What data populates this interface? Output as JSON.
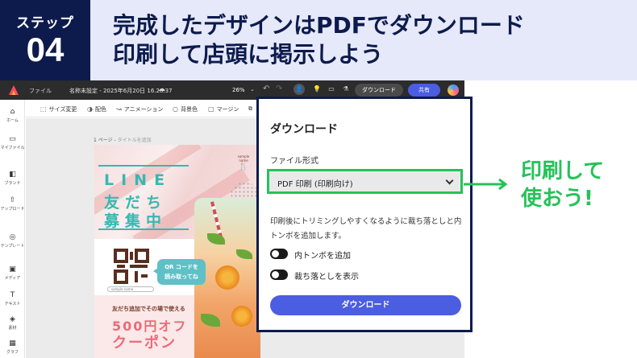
{
  "banner": {
    "step_label": "ステップ",
    "step_number": "04",
    "title_line1": "完成したデザインはPDFでダウンロード",
    "title_line2": "印刷して店頭に掲示しよう"
  },
  "app": {
    "topbar": {
      "menu_file": "ファイル",
      "document_name": "名称未設定 - 2025年6月20日 16.28.37",
      "zoom": "26%",
      "download_label": "ダウンロード",
      "share_label": "共有"
    },
    "sidebar": [
      {
        "icon": "home-icon",
        "label": "ホーム"
      },
      {
        "icon": "folder-icon",
        "label": "マイファイル"
      },
      {
        "icon": "brand-icon",
        "label": "ブランド"
      },
      {
        "icon": "upload-icon",
        "label": "アップロード"
      },
      {
        "icon": "template-icon",
        "label": "テンプレート"
      },
      {
        "icon": "media-icon",
        "label": "メディア"
      },
      {
        "icon": "text-icon",
        "label": "テキスト"
      },
      {
        "icon": "elements-icon",
        "label": "素材"
      },
      {
        "icon": "graphics-icon",
        "label": "グラフ"
      }
    ],
    "toolbar": {
      "resize": "サイズ変更",
      "color": "配色",
      "animation": "アニメーション",
      "background": "背景色",
      "margin": "マージン"
    },
    "canvas": {
      "page_label": "1 ページ - ",
      "page_title_placeholder": "タイトルを追加"
    },
    "flyer": {
      "line1": "LINE",
      "line2": "友だち",
      "line3": "募集中",
      "logo_text": "sample name",
      "bubble_line1": "QR コードを",
      "bubble_line2": "読み取ってね",
      "sample_name": "sample name",
      "promo": "友だち追加でその場で使える",
      "discount": "500円オフ",
      "coupon": "クーポン"
    }
  },
  "download_panel": {
    "title": "ダウンロード",
    "file_format_label": "ファイル形式",
    "file_format_value": "PDF 印刷 (印刷向け)",
    "description": "印刷後にトリミングしやすくなるように裁ち落としと内トンボを追加します。",
    "toggle_crop_marks": "内トンボを追加",
    "toggle_bleed": "裁ち落としを表示",
    "toggle_crop_marks_on": true,
    "toggle_bleed_on": true,
    "download_button": "ダウンロード"
  },
  "callout": {
    "line1": "印刷して",
    "line2": "使おう!"
  },
  "colors": {
    "navy": "#0d1b4c",
    "banner_bg": "#e6e9f9",
    "accent_green": "#26c25a",
    "button_blue": "#4b5de0",
    "flyer_teal": "#35b9b2",
    "flyer_pink": "#ec6a78"
  }
}
